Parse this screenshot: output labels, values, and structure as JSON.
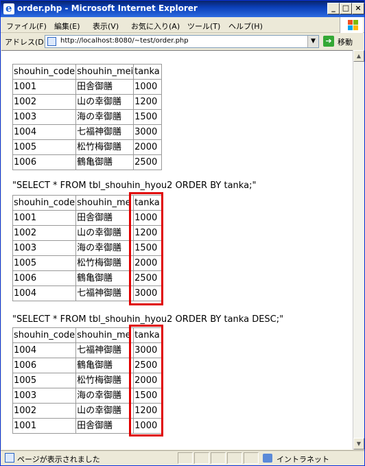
{
  "window": {
    "title": "order.php - Microsoft Internet Explorer",
    "min": "_",
    "max": "□",
    "close": "×"
  },
  "menu": [
    "ファイル(F)",
    "編集(E)",
    "表示(V)",
    "お気に入り(A)",
    "ツール(T)",
    "ヘルプ(H)"
  ],
  "address": {
    "label": "アドレス(D)",
    "url": "http://localhost:8080/~test/order.php",
    "go_label": "移動"
  },
  "columns": [
    "shouhin_code",
    "shouhin_mei",
    "tanka"
  ],
  "tables": [
    {
      "caption": "",
      "headers": [
        "shouhin_code",
        "shouhin_mei",
        "tanka"
      ],
      "rows": [
        [
          "1001",
          "田舎御膳",
          "1000"
        ],
        [
          "1002",
          "山の幸御膳",
          "1200"
        ],
        [
          "1003",
          "海の幸御膳",
          "1500"
        ],
        [
          "1004",
          "七福神御膳",
          "3000"
        ],
        [
          "1005",
          "松竹梅御膳",
          "2000"
        ],
        [
          "1006",
          "鶴亀御膳",
          "2500"
        ]
      ]
    },
    {
      "caption": "\"SELECT * FROM tbl_shouhin_hyou2 ORDER BY tanka;\"",
      "headers": [
        "shouhin_code",
        "shouhin_me",
        "tanka"
      ],
      "rows": [
        [
          "1001",
          "田舎御膳",
          "1000"
        ],
        [
          "1002",
          "山の幸御膳",
          "1200"
        ],
        [
          "1003",
          "海の幸御膳",
          "1500"
        ],
        [
          "1005",
          "松竹梅御膳",
          "2000"
        ],
        [
          "1006",
          "鶴亀御膳",
          "2500"
        ],
        [
          "1004",
          "七福神御膳",
          "3000"
        ]
      ]
    },
    {
      "caption": "\"SELECT * FROM tbl_shouhin_hyou2 ORDER BY tanka DESC;\"",
      "headers": [
        "shouhin_code",
        "shouhin_me",
        "tanka"
      ],
      "rows": [
        [
          "1004",
          "七福神御膳",
          "3000"
        ],
        [
          "1006",
          "鶴亀御膳",
          "2500"
        ],
        [
          "1005",
          "松竹梅御膳",
          "2000"
        ],
        [
          "1003",
          "海の幸御膳",
          "1500"
        ],
        [
          "1002",
          "山の幸御膳",
          "1200"
        ],
        [
          "1001",
          "田舎御膳",
          "1000"
        ]
      ]
    }
  ],
  "status": {
    "text": "ページが表示されました",
    "zone": "イントラネット"
  },
  "colors": {
    "highlight": "#e00000",
    "titlebar": "#0b3fb8"
  }
}
